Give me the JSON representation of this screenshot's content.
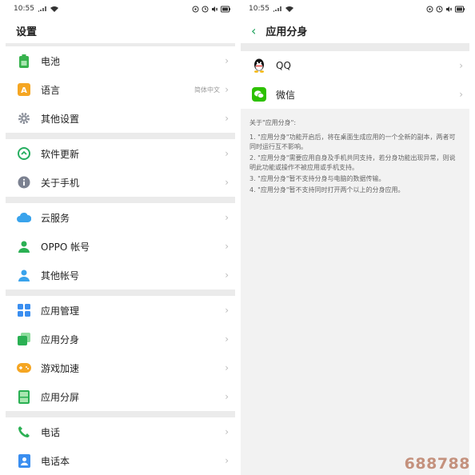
{
  "status_bar": {
    "time": "10:55"
  },
  "settings": {
    "title": "设置",
    "groups": [
      {
        "items": [
          {
            "label": "电池",
            "icon": "battery-icon"
          },
          {
            "label": "语言",
            "value": "简体中文",
            "icon": "language-icon"
          },
          {
            "label": "其他设置",
            "icon": "gear-icon"
          }
        ]
      },
      {
        "items": [
          {
            "label": "软件更新",
            "icon": "update-icon"
          },
          {
            "label": "关于手机",
            "icon": "info-icon"
          }
        ]
      },
      {
        "items": [
          {
            "label": "云服务",
            "icon": "cloud-icon"
          },
          {
            "label": "OPPO 帐号",
            "icon": "user-icon"
          },
          {
            "label": "其他帐号",
            "icon": "user-icon"
          }
        ]
      },
      {
        "items": [
          {
            "label": "应用管理",
            "icon": "grid-icon"
          },
          {
            "label": "应用分身",
            "icon": "clone-icon"
          },
          {
            "label": "游戏加速",
            "icon": "gamepad-icon"
          },
          {
            "label": "应用分屏",
            "icon": "split-screen-icon"
          }
        ]
      },
      {
        "items": [
          {
            "label": "电话",
            "icon": "phone-icon"
          },
          {
            "label": "电话本",
            "icon": "contacts-icon"
          }
        ]
      }
    ]
  },
  "clone_page": {
    "title": "应用分身",
    "apps": [
      {
        "label": "QQ",
        "icon": "qq-icon"
      },
      {
        "label": "微信",
        "icon": "wechat-icon"
      }
    ],
    "description": {
      "title": "关于\"应用分身\":",
      "items": [
        "1. \"应用分身\"功能开启后，将在桌面生成应用的一个全新的副本，两者可同时运行互不影响。",
        "2. \"应用分身\"需要应用自身及手机共同支持，若分身功能出现异常，则说明此功能或操作不被应用或手机支持。",
        "3. \"应用分身\"暂不支持分身与电脑的数据传输。",
        "4. \"应用分身\"暂不支持同时打开两个以上的分身应用。"
      ]
    }
  },
  "watermark": "688788",
  "colors": {
    "accent_green": "#1aa15a",
    "qq_yellow": "#f5b400",
    "wechat_green": "#2dc100",
    "cloud_blue": "#39a3ec"
  }
}
